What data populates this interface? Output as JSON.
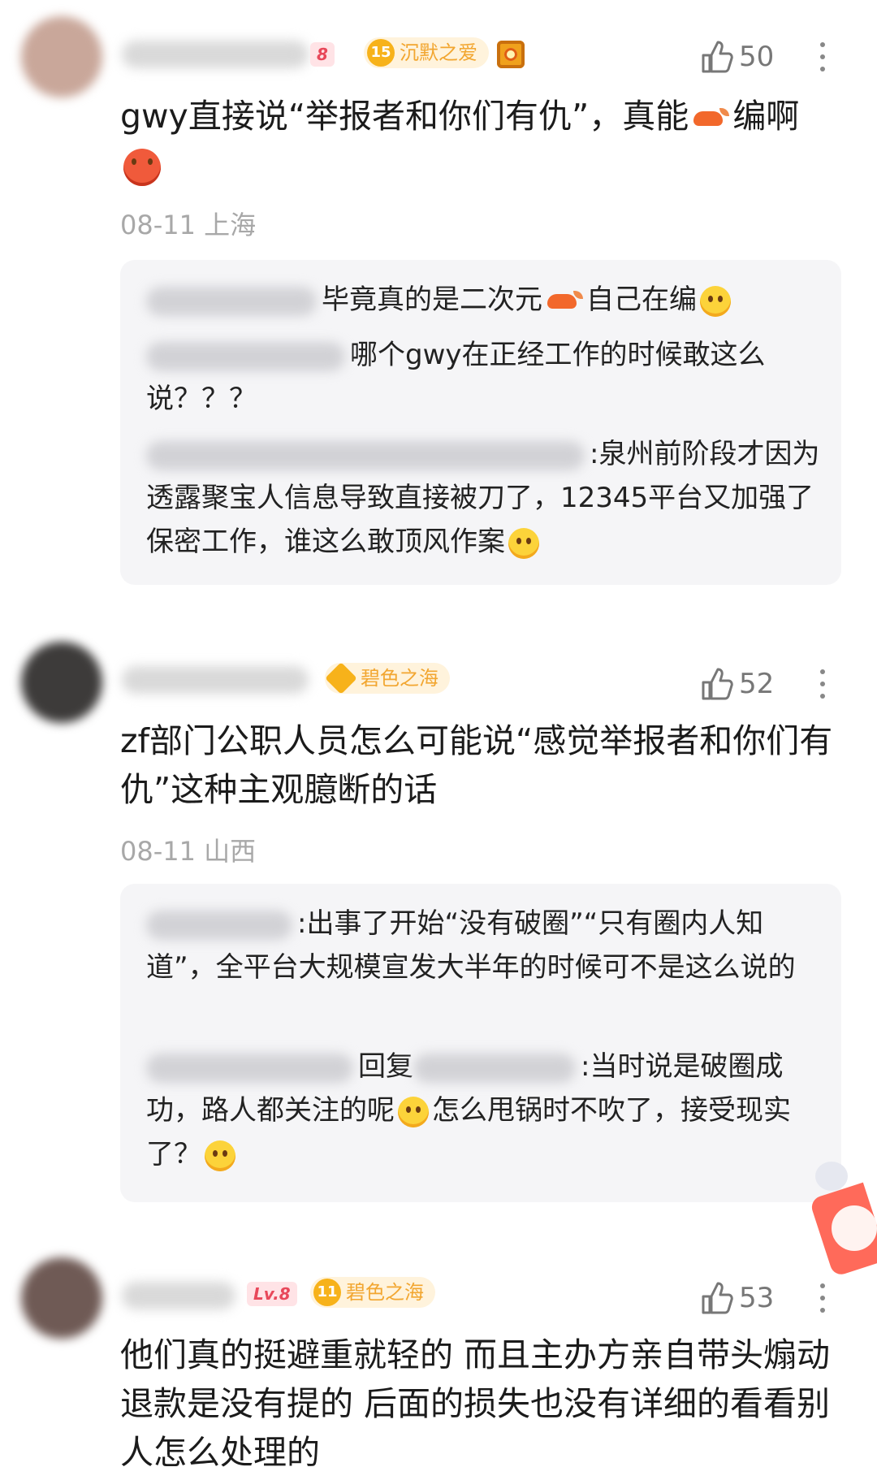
{
  "comments": [
    {
      "level_badge": "8",
      "fan_level": "15",
      "fan_title": "沉默之爱",
      "likes": "50",
      "text": "gwy直接说“举报者和你们有仇”，真能",
      "text_tail": "编啊",
      "date": "08-11",
      "location": "上海",
      "replies": [
        {
          "text": "毕竟真的是二次元",
          "text_tail": "自己在编"
        },
        {
          "text": "哪个gwy在正经工作的时候敢这么说？？？"
        },
        {
          "text": ":泉州前阶段才因为透露聚宝人信息导致直接被刀了，12345平台又加强了保密工作，谁这么敢顶风作案"
        }
      ]
    },
    {
      "fan_title": "碧色之海",
      "likes": "52",
      "text": "zf部门公职人员怎么可能说“感觉举报者和你们有仇”这种主观臆断的话",
      "date": "08-11",
      "location": "山西",
      "replies": [
        {
          "text": ":出事了开始“没有破圈”“只有圈内人知道”，全平台大规模宣发大半年的时候可不是这么说的"
        },
        {
          "reply_word": "回复",
          "text": ":当时说是破圈成功，路人都关注的呢",
          "text_tail": "怎么甩锅时不吹了，接受现实了？"
        }
      ]
    },
    {
      "level_badge": "Lv.8",
      "fan_level": "11",
      "fan_title": "碧色之海",
      "likes": "53",
      "text": "他们真的挺避重就轻的 而且主办方亲自带头煽动 退款是没有提的 后面的损失也没有详细的看看别人怎么处理的"
    }
  ],
  "colors": {
    "accent_gold": "#f7b21a",
    "meta_gray": "#a8a8a8",
    "reply_bg": "#f5f5f7"
  },
  "icons": [
    "thumb-up-icon",
    "more-icon",
    "shrimp-emoji",
    "smile-emoji",
    "laugh-emoji",
    "red-face-emoji",
    "medal-icon",
    "gem-icon"
  ]
}
